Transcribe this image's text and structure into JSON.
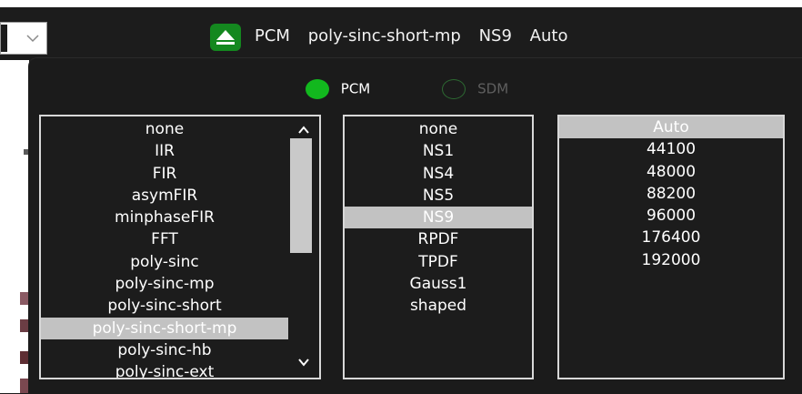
{
  "header": {
    "summary": [
      "PCM",
      "poly-sinc-short-mp",
      "NS9",
      "Auto"
    ]
  },
  "mode": {
    "options": [
      {
        "label": "PCM",
        "selected": true
      },
      {
        "label": "SDM",
        "selected": false
      }
    ]
  },
  "filter_list": {
    "items": [
      "none",
      "IIR",
      "FIR",
      "asymFIR",
      "minphaseFIR",
      "FFT",
      "poly-sinc",
      "poly-sinc-mp",
      "poly-sinc-short",
      "poly-sinc-short-mp",
      "poly-sinc-hb",
      "poly-sinc-ext"
    ],
    "selected": "poly-sinc-short-mp"
  },
  "shaper_list": {
    "items": [
      "none",
      "NS1",
      "NS4",
      "NS5",
      "NS9",
      "RPDF",
      "TPDF",
      "Gauss1",
      "shaped"
    ],
    "selected": "NS9"
  },
  "rate_list": {
    "items": [
      "Auto",
      "44100",
      "48000",
      "88200",
      "96000",
      "176400",
      "192000"
    ],
    "selected": "Auto"
  },
  "colors": {
    "accent_green": "#12b81e",
    "button_green": "#14881f",
    "selection_gray": "#c2c2c2",
    "panel_bg": "#1b1b1b"
  }
}
